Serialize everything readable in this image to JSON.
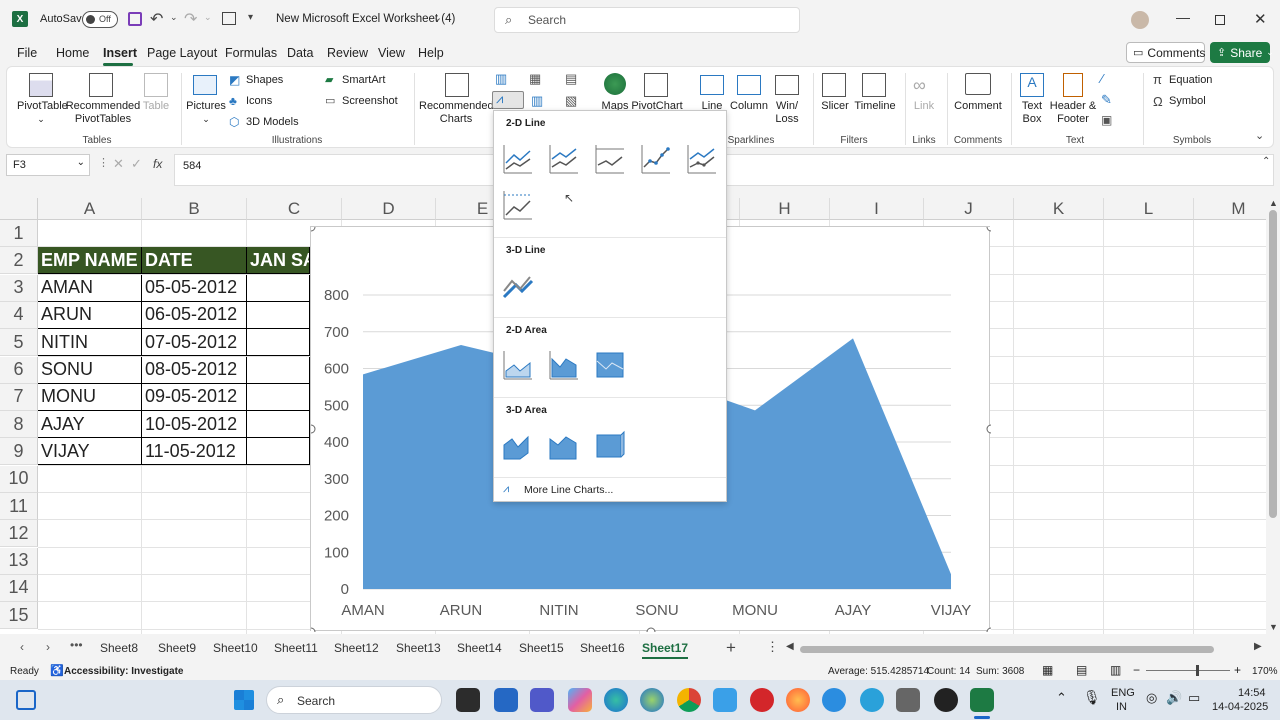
{
  "titlebar": {
    "app_icon": "excel-icon",
    "autosave_label": "AutoSave",
    "autosave_state": "Off",
    "doc_title": "New Microsoft Excel Worksheet (4)",
    "search_placeholder": "Search"
  },
  "menu": [
    "File",
    "Home",
    "Insert",
    "Page Layout",
    "Formulas",
    "Data",
    "Review",
    "View",
    "Help"
  ],
  "active_menu": "Insert",
  "top_right": {
    "comments": "Comments",
    "share": "Share"
  },
  "ribbon": {
    "pivottable": "PivotTable",
    "recommended_pivottables": "Recommended PivotTables",
    "table": "Table",
    "tables_group": "Tables",
    "pictures": "Pictures",
    "shapes": "Shapes",
    "icons": "Icons",
    "models3d": "3D Models",
    "smartart": "SmartArt",
    "screenshot": "Screenshot",
    "illustrations_group": "Illustrations",
    "recommended_charts": "Recommended Charts",
    "maps": "Maps",
    "pivotchart": "PivotChart",
    "line": "Line",
    "column": "Column",
    "winloss": "Win/ Loss",
    "sparklines_group": "Sparklines",
    "slicer": "Slicer",
    "timeline": "Timeline",
    "filters_group": "Filters",
    "link": "Link",
    "links_group": "Links",
    "comment": "Comment",
    "comments_group": "Comments",
    "textbox": "Text Box",
    "header_footer": "Header & Footer",
    "text_group": "Text",
    "equation": "Equation",
    "symbol": "Symbol",
    "symbols_group": "Symbols"
  },
  "formula_bar": {
    "name_box": "F3",
    "fx": "fx",
    "value": "584"
  },
  "columns": [
    "A",
    "B",
    "C",
    "D",
    "E",
    "F",
    "G",
    "H",
    "I",
    "J",
    "K",
    "L",
    "M"
  ],
  "rows": [
    "1",
    "2",
    "3",
    "4",
    "5",
    "6",
    "7",
    "8",
    "9",
    "10",
    "11",
    "12",
    "13",
    "14",
    "15"
  ],
  "table": {
    "headers": [
      "EMP NAME",
      "DATE",
      "JAN SA"
    ],
    "rows": [
      [
        "AMAN",
        "05-05-2012"
      ],
      [
        "ARUN",
        "06-05-2012"
      ],
      [
        "NITIN",
        "07-05-2012"
      ],
      [
        "SONU",
        "08-05-2012"
      ],
      [
        "MONU",
        "09-05-2012"
      ],
      [
        "AJAY",
        "10-05-2012"
      ],
      [
        "VIJAY",
        "11-05-2012"
      ]
    ]
  },
  "chart_data": {
    "type": "area",
    "categories": [
      "AMAN",
      "ARUN",
      "NITIN",
      "SONU",
      "MONU",
      "AJAY",
      "VIJAY"
    ],
    "series": [
      {
        "values": [
          584,
          664,
          600,
          580,
          486,
          682,
          40
        ]
      }
    ],
    "ylim": [
      0,
      800
    ],
    "yticks": [
      "0",
      "100",
      "200",
      "300",
      "400",
      "500",
      "600",
      "700",
      "800"
    ],
    "grid": true,
    "color": "#5b9bd5"
  },
  "dropdown": {
    "section_2d_line": "2-D Line",
    "section_3d_line": "3-D Line",
    "section_2d_area": "2-D Area",
    "section_3d_area": "3-D Area",
    "more": "More Line Charts..."
  },
  "sheets": [
    "Sheet8",
    "Sheet9",
    "Sheet10",
    "Sheet11",
    "Sheet12",
    "Sheet13",
    "Sheet14",
    "Sheet15",
    "Sheet16",
    "Sheet17"
  ],
  "active_sheet": "Sheet17",
  "status": {
    "ready": "Ready",
    "accessibility": "Accessibility: Investigate",
    "average": "Average: 515.4285714",
    "count": "Count: 14",
    "sum": "Sum: 3608",
    "zoom": "170%"
  },
  "taskbar": {
    "search": "Search",
    "lang1": "ENG",
    "lang2": "IN",
    "time": "14:54",
    "date": "14-04-2025"
  }
}
